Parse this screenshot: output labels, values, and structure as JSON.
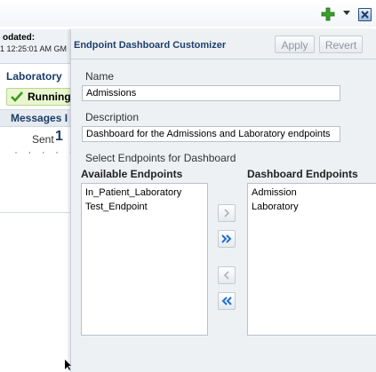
{
  "toolbar": {
    "add_icon": "green-plus-icon",
    "menu_icon": "dropdown-arrow-icon",
    "close_icon": "close-x-icon"
  },
  "background_panel": {
    "updated_label": "odated:",
    "updated_time": "1 12:25:01 AM GM",
    "lab_title": "Laboratory",
    "status": "Running",
    "messages_label": "Messages I",
    "sent_label": "Sent",
    "sent_count": "1",
    "dots": "· · · · · · ·"
  },
  "dialog": {
    "title": "Endpoint Dashboard Customizer",
    "apply_label": "Apply",
    "revert_label": "Revert",
    "name_label": "Name",
    "name_value": "Admissions",
    "description_label": "Description",
    "description_value": "Dashboard for the Admissions and Laboratory endpoints",
    "select_label": "Select Endpoints for Dashboard",
    "available_label": "Available Endpoints",
    "dashboard_label": "Dashboard Endpoints",
    "available_items": [
      "In_Patient_Laboratory",
      "Test_Endpoint"
    ],
    "dashboard_items": [
      "Admission",
      "Laboratory"
    ],
    "shuttle_icons": [
      "move-right-icon",
      "move-all-right-icon",
      "move-left-icon",
      "move-all-left-icon"
    ]
  },
  "colors": {
    "accent": "#1c3f6e",
    "shuttle_active": "#1f6fd1",
    "shuttle_disabled": "#a9b0b8",
    "status_ok": "#3a9a1c"
  }
}
